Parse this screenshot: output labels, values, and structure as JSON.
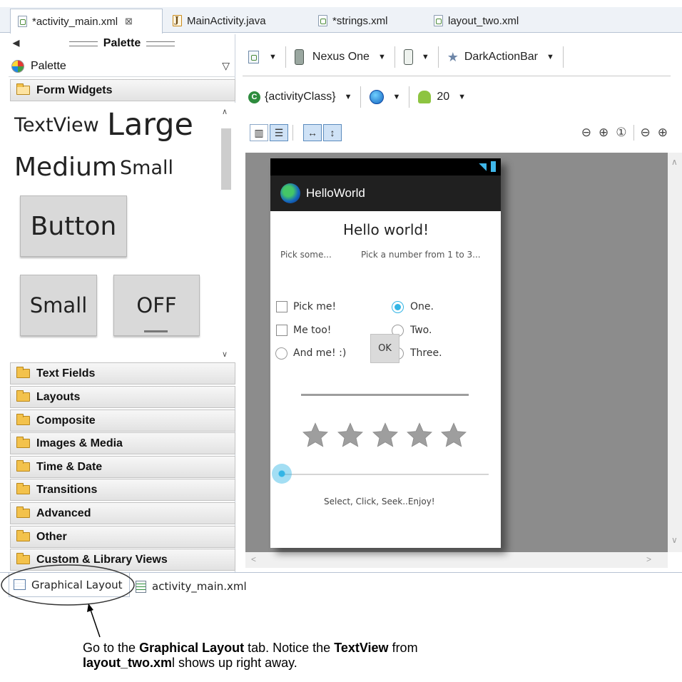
{
  "editor_tabs": [
    {
      "label": "*activity_main.xml",
      "close": "⊠"
    },
    {
      "label": "MainActivity.java"
    },
    {
      "label": "*strings.xml"
    },
    {
      "label": "layout_two.xml"
    }
  ],
  "palette": {
    "header": "Palette",
    "selector": "Palette",
    "open_category": "Form Widgets",
    "widgets": {
      "textview": "TextView",
      "large": "Large",
      "medium": "Medium",
      "small": "Small",
      "button": "Button",
      "small_button": "Small",
      "toggle": "OFF"
    },
    "categories": [
      "Text Fields",
      "Layouts",
      "Composite",
      "Images & Media",
      "Time & Date",
      "Transitions",
      "Advanced",
      "Other",
      "Custom & Library Views"
    ]
  },
  "toolbar": {
    "device": "Nexus One",
    "theme": "DarkActionBar",
    "activity": "{activityClass}",
    "api_level": "20"
  },
  "device_screen": {
    "app_title": "HelloWorld",
    "heading": "Hello world!",
    "left_label": "Pick some...",
    "right_label": "Pick a number from 1 to 3...",
    "checkboxes": [
      {
        "label": "Pick me!",
        "checked": false
      },
      {
        "label": "Me too!",
        "checked": false
      }
    ],
    "left_radio": {
      "label": "And me! :)",
      "checked": false
    },
    "radios": [
      {
        "label": "One.",
        "checked": true
      },
      {
        "label": "Two.",
        "checked": false
      },
      {
        "label": "Three.",
        "checked": false
      }
    ],
    "ok_button": "OK",
    "rating_stars": 5,
    "rating_value": 0,
    "seekbar_value": 0,
    "footer": "Select, Click, Seek..Enjoy!"
  },
  "bottom_tabs": [
    {
      "label": "Graphical Layout"
    },
    {
      "label": "activity_main.xml"
    }
  ],
  "caption": {
    "t1": "Go to the ",
    "b1": "Graphical Layout",
    "t2": " tab. Notice the ",
    "b2": "TextView",
    "t3": " from ",
    "b3": "layout_two.xm",
    "t4": "l shows up right away."
  },
  "colors": {
    "accent": "#33b5e5",
    "actionbar": "#202020",
    "canvas": "#8c8c8c"
  }
}
